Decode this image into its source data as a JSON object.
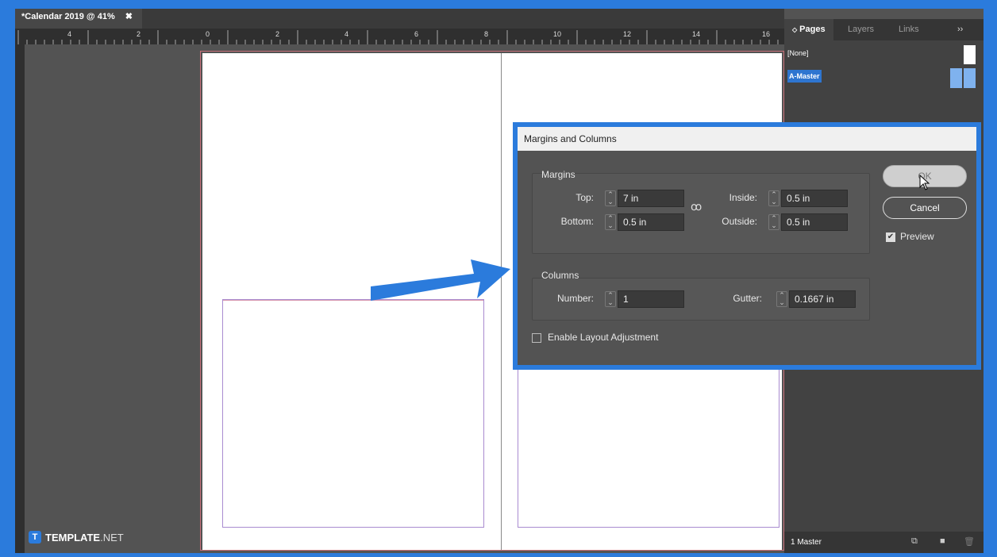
{
  "document_tab": {
    "title": "*Calendar 2019 @ 41%",
    "close_glyph": "✖"
  },
  "ruler": {
    "labels": [
      "4",
      "2",
      "0",
      "2",
      "4",
      "6",
      "8",
      "10",
      "12",
      "14",
      "16"
    ]
  },
  "pages_panel": {
    "tabs": [
      {
        "label": "Pages",
        "active": true
      },
      {
        "label": "Layers",
        "active": false
      },
      {
        "label": "Links",
        "active": false
      }
    ],
    "menu_glyph": "››",
    "masters": [
      {
        "label": "[None]",
        "selected": false
      },
      {
        "label": "A-Master",
        "selected": true
      }
    ],
    "footer_text": "1 Master"
  },
  "dialog": {
    "title": "Margins and Columns",
    "margins": {
      "label": "Margins",
      "top_label": "Top:",
      "top_value": "7 in",
      "bottom_label": "Bottom:",
      "bottom_value": "0.5 in",
      "inside_label": "Inside:",
      "inside_value": "0.5 in",
      "outside_label": "Outside:",
      "outside_value": "0.5 in"
    },
    "columns": {
      "label": "Columns",
      "number_label": "Number:",
      "number_value": "1",
      "gutter_label": "Gutter:",
      "gutter_value": "0.1667 in"
    },
    "ok_label": "OK",
    "cancel_label": "Cancel",
    "preview_label": "Preview",
    "preview_checked": true,
    "enable_layout_label": "Enable Layout Adjustment",
    "enable_layout_checked": false
  },
  "watermark": {
    "brand": "TEMPLATE",
    "suffix": ".NET",
    "logo_letter": "T"
  },
  "colors": {
    "accent": "#2b7bdc",
    "selection": "#2e75d0",
    "canvas": "#535353"
  }
}
